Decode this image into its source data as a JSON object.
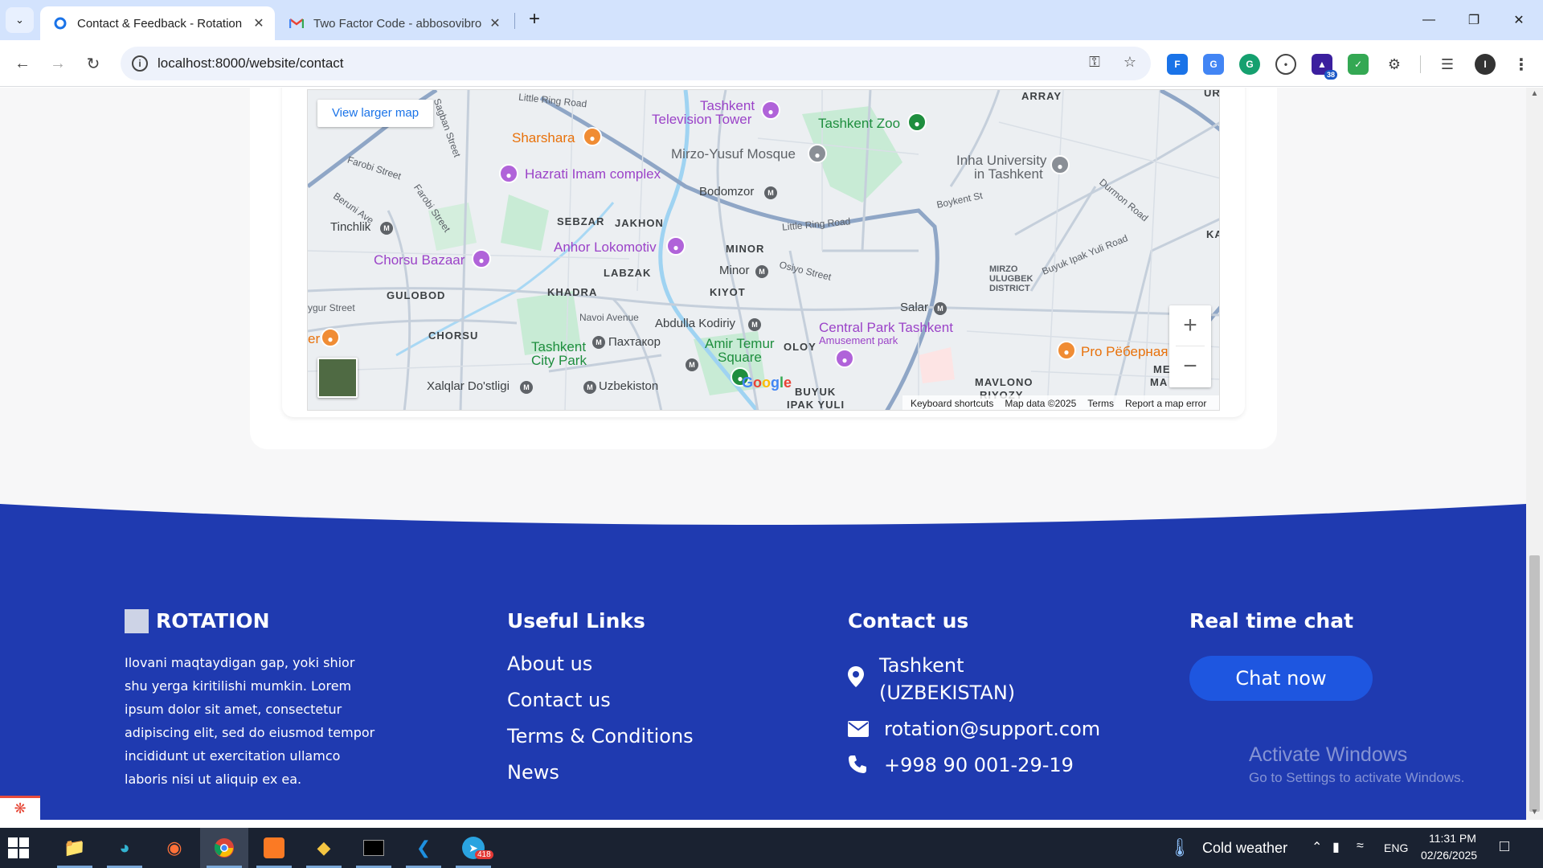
{
  "browser": {
    "tabs": [
      {
        "title": "Contact & Feedback - Rotation",
        "favicon": "rotation-favicon",
        "active": true
      },
      {
        "title": "Two Factor Code - abbosovibro",
        "favicon": "gmail-icon",
        "active": false
      }
    ],
    "url": "localhost:8000/website/contact",
    "extension_badge": "38"
  },
  "map": {
    "view_larger": "View larger map",
    "attribution": {
      "shortcuts": "Keyboard shortcuts",
      "data": "Map data ©2025",
      "terms": "Terms",
      "report": "Report a map error"
    },
    "labels": {
      "little_ring_road_1": "Little Ring Road",
      "little_ring_road_2": "Little Ring Road",
      "tashkent_tower_1": "Tashkent",
      "tashkent_tower_2": "Television Tower",
      "tashkent_zoo": "Tashkent Zoo",
      "array": "ARRAY",
      "sharshara": "Sharshara",
      "mirzo_yusuf": "Mirzo-Yusuf Mosque",
      "inha_1": "Inha University",
      "inha_2": "in Tashkent",
      "farobi_street": "Farobi Street",
      "hazrati_imam": "Hazrati Imam complex",
      "bodomzor": "Bodomzor",
      "boykent": "Boykent St",
      "durmon": "Durmon Road",
      "beruni": "Beruni Ave",
      "farobi_street_2": "Farobi Street",
      "sagban": "Sagban Street",
      "sebzar": "SEBZAR",
      "jakhon": "JAKHON",
      "tinchlik": "Tinchlik",
      "anhor": "Anhor Lokomotiv",
      "minor_area": "MINOR",
      "chorsu_bazaar": "Chorsu Bazaar",
      "labzak": "LABZAK",
      "minor_metro": "Minor",
      "osiyo": "Osiyo Street",
      "mirzo_ulugbek_1": "MIRZO",
      "mirzo_ulugbek_2": "ULUGBEK",
      "mirzo_ulugbek_3": "DISTRICT",
      "buyuk_ipak": "Buyuk Ipak Yuli Road",
      "gulobod": "GULOBOD",
      "khadra": "KHADRA",
      "kiyot": "KIYOT",
      "salar": "Salar",
      "uygur": "ygur Street",
      "navoi": "Navoi Avenue",
      "abdulla": "Abdulla Kodiriy",
      "central_park": "Central Park Tashkent",
      "amusement": "Amusement park",
      "chorsu": "CHORSU",
      "tashkent_city_1": "Tashkent",
      "tashkent_city_2": "City Park",
      "paxtakor": "Пахтакор",
      "amir_temur_1": "Amir Temur",
      "amir_temur_2": "Square",
      "oloy": "OLOY",
      "pro_rebernaya": "Pro Рёберная",
      "xalqlar": "Xalqlar Do'stligi",
      "uzbekiston": "Uzbekiston",
      "buyuk_1": "BUYUK",
      "buyuk_2": "IPAK YULI",
      "mavlono_1": "MAVLONO",
      "mavlono_2": "RIYOZY",
      "ka": "KA",
      "er": "er",
      "ur": "UR",
      "me": "ME",
      "ma": "MA"
    }
  },
  "footer": {
    "brand": "ROTATION",
    "description": "Ilovani maqtaydigan gap, yoki shior shu yerga kiritilishi mumkin. Lorem ipsum dolor sit amet, consectetur adipiscing elit, sed do eiusmod tempor incididunt ut exercitation ullamco laboris nisi ut aliquip ex ea.",
    "useful_links": {
      "heading": "Useful Links",
      "items": [
        "About us",
        "Contact us",
        "Terms & Conditions",
        "News"
      ]
    },
    "contact": {
      "heading": "Contact us",
      "address_line1": "Tashkent",
      "address_line2": "(UZBEKISTAN)",
      "email": "rotation@support.com",
      "phone": "+998 90 001-29-19"
    },
    "chat": {
      "heading": "Real time chat",
      "button": "Chat now"
    },
    "colors": {
      "footer_bg": "#1f3ab0",
      "chat_button": "#1e56e0"
    }
  },
  "windows_watermark": {
    "line1": "Activate Windows",
    "line2": "Go to Settings to activate Windows."
  },
  "taskbar": {
    "weather": "Cold weather",
    "lang": "ENG",
    "time": "11:31 PM",
    "date": "02/26/2025",
    "telegram_badge": "418"
  }
}
